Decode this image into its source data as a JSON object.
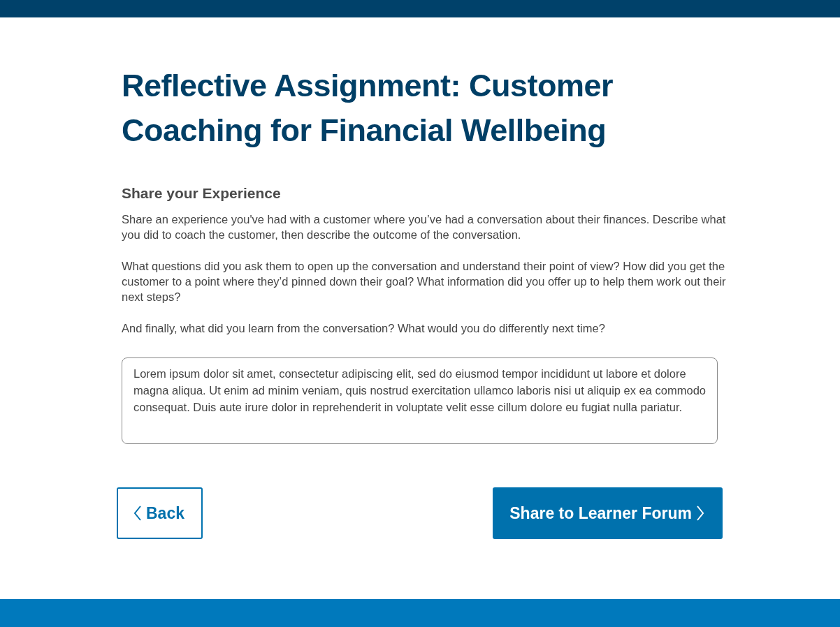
{
  "title": "Reflective Assignment: Customer Coaching for Financial Wellbeing",
  "section": {
    "heading": "Share your Experience",
    "paragraphs": [
      "Share an experience you've had with a customer where you’ve had a conversation about their finances. Describe what you did to coach the customer, then describe the outcome of the conversation.",
      "What questions did you ask them to open up the conversation and understand their point of view? How did you get the customer to a point where they’d pinned down their goal? What information did you offer up to help them work out their next steps?",
      "And finally, what did you learn from the conversation? What would you do differently next time?"
    ]
  },
  "answer": {
    "value": "Lorem ipsum dolor sit amet, consectetur adipiscing elit, sed do eiusmod tempor incididunt ut labore et dolore magna aliqua. Ut enim ad minim veniam, quis nostrud exercitation ullamco laboris nisi ut aliquip ex ea commodo consequat. Duis aute irure dolor in reprehenderit in voluptate velit esse cillum dolore eu fugiat nulla pariatur."
  },
  "buttons": [
    {
      "label": "Back",
      "kind": "secondary"
    },
    {
      "label": "Share to Learner Forum",
      "kind": "primary"
    }
  ]
}
